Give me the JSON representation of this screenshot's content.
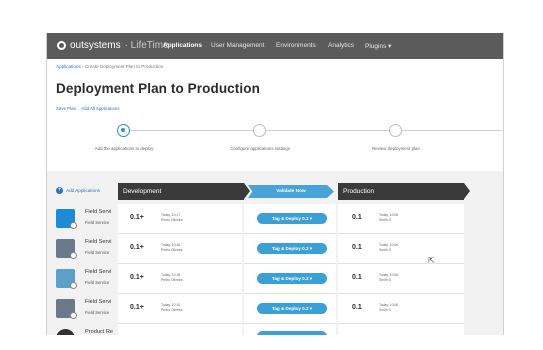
{
  "topbar": {
    "logo_main": "outsystems",
    "logo_sub": "· LifeTime",
    "nav": [
      "Applications",
      "User Management",
      "Environments",
      "Analytics",
      "Plugins ▾"
    ]
  },
  "breadcrumb": {
    "root": "Applications",
    "sep": " › ",
    "current": "Create Deployment Plan to Production"
  },
  "title": "Deployment Plan to Production",
  "actions": {
    "save": "Save Plan",
    "add_all": "Add All Applications"
  },
  "steps": [
    "Add the applications to deploy",
    "Configure applications settings",
    "Review deployment plan"
  ],
  "add_applications": "Add Applications",
  "env": {
    "source": "Development",
    "validate": "Validate Now",
    "target": "Production"
  },
  "rows": [
    {
      "name": "Field Servi",
      "sub": "Field Service",
      "dev_ver": "0.1+",
      "dev_when": "Today, 10:17",
      "dev_who": "Pedro Oliveira",
      "action": "Tag & Deploy 0.2 ▾",
      "prod_ver": "0.1",
      "prod_when": "Today, 10:06",
      "prod_who": "Smith O",
      "icon_color": "#1f8ad6"
    },
    {
      "name": "Field Servi",
      "sub": "Field Service",
      "dev_ver": "0.1+",
      "dev_when": "Today, 10:16",
      "dev_who": "Pedro Oliveira",
      "action": "Tag & Deploy 0.2 ▾",
      "prod_ver": "0.1",
      "prod_when": "Today, 10:06",
      "prod_who": "Smith O",
      "icon_color": "#6b7a8a"
    },
    {
      "name": "Field Servi",
      "sub": "Field Service",
      "dev_ver": "0.1+",
      "dev_when": "Today, 10:16",
      "dev_who": "Pedro Oliveira",
      "action": "Tag & Deploy 0.2 ▾",
      "prod_ver": "0.1",
      "prod_when": "Today, 10:06",
      "prod_who": "Smith O",
      "icon_color": "#5aa0c8"
    },
    {
      "name": "Field Servi",
      "sub": "Field Service",
      "dev_ver": "0.1+",
      "dev_when": "Today, 10:16",
      "dev_who": "Pedro Oliveira",
      "action": "Tag & Deploy 0.2 ▾",
      "prod_ver": "0.1",
      "prod_when": "Today, 10:06",
      "prod_who": "Smith O",
      "icon_color": "#6b7a8a"
    },
    {
      "name": "Product Re",
      "sub": "",
      "dev_ver": "",
      "dev_when": "",
      "dev_who": "",
      "action": "",
      "prod_ver": "",
      "prod_when": "",
      "prod_who": "",
      "icon_color": "#333333"
    }
  ],
  "colors": {
    "topbar": "#5b5b5b",
    "accent": "#2a8fd6",
    "env_header": "#3a3a3a",
    "button": "#3aa0d5"
  }
}
